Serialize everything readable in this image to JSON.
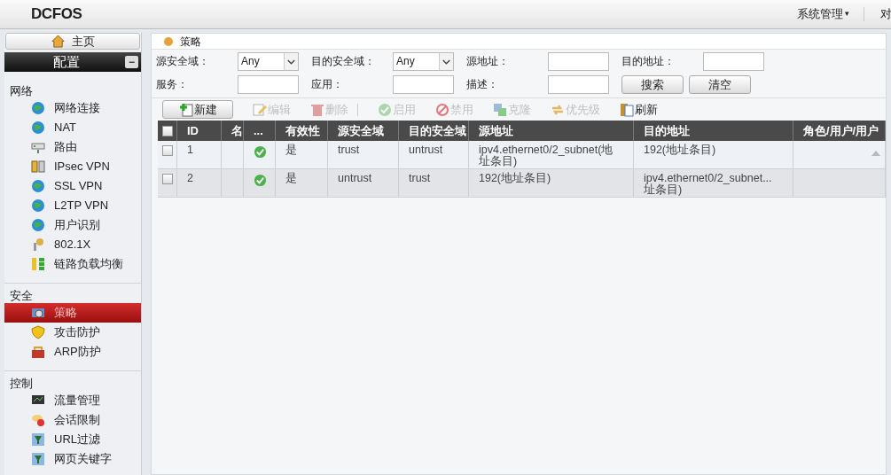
{
  "header": {
    "logo": "DCFOS",
    "menu": "系统管理",
    "menu_caret": "▾",
    "cut_item": "对"
  },
  "sidebar": {
    "home": "主页",
    "section": "配置",
    "collapse": "−",
    "groups": [
      {
        "title": "网络",
        "items": [
          {
            "label": "网络连接",
            "selected": false
          },
          {
            "label": "NAT",
            "selected": false
          },
          {
            "label": "路由",
            "selected": false
          },
          {
            "label": "IPsec VPN",
            "selected": false
          },
          {
            "label": "SSL VPN",
            "selected": false
          },
          {
            "label": "L2TP VPN",
            "selected": false
          },
          {
            "label": "用户识别",
            "selected": false
          },
          {
            "label": "802.1X",
            "selected": false
          },
          {
            "label": "链路负载均衡",
            "selected": false
          }
        ]
      },
      {
        "title": "安全",
        "items": [
          {
            "label": "策略",
            "selected": true
          },
          {
            "label": "攻击防护",
            "selected": false
          },
          {
            "label": "ARP防护",
            "selected": false
          }
        ]
      },
      {
        "title": "控制",
        "items": [
          {
            "label": "流量管理",
            "selected": false
          },
          {
            "label": "会话限制",
            "selected": false
          },
          {
            "label": "URL过滤",
            "selected": false
          },
          {
            "label": "网页关键字",
            "selected": false
          }
        ]
      }
    ]
  },
  "panel": {
    "title": "策略",
    "filters": [
      [
        {
          "label": "源安全域：",
          "kind": "select",
          "value": "Any"
        },
        {
          "label": "目的安全域：",
          "kind": "select",
          "value": "Any"
        },
        {
          "label": "源地址：",
          "kind": "input"
        },
        {
          "label": "目的地址：",
          "kind": "input"
        }
      ],
      [
        {
          "label": "服务：",
          "kind": "input"
        },
        {
          "label": "应用：",
          "kind": "input"
        },
        {
          "label": "描述：",
          "kind": "input"
        }
      ]
    ],
    "buttons": [
      "搜索",
      "清空"
    ],
    "toolbar": [
      {
        "label": "新建",
        "disabled": false
      },
      {
        "label": "编辑",
        "disabled": true
      },
      {
        "label": "删除",
        "disabled": true
      },
      {
        "label": "启用",
        "disabled": true
      },
      {
        "label": "禁用",
        "disabled": true
      },
      {
        "label": "克隆",
        "disabled": true
      },
      {
        "label": "优先级",
        "disabled": true
      },
      {
        "label": "刷新",
        "disabled": false
      }
    ],
    "table": {
      "select_all_checked": false,
      "columns": [
        "ID",
        "名",
        "...",
        "有效性",
        "源安全域",
        "目的安全域",
        "源地址",
        "目的地址",
        "角色/用户/用户"
      ],
      "rows": [
        {
          "checked": false,
          "enabled": true,
          "cells": [
            "1",
            "",
            "",
            "是",
            "trust",
            "untrust",
            "ipv4.ethernet0/2_subnet(地址条目)",
            "192(地址条目)",
            ""
          ]
        },
        {
          "checked": false,
          "enabled": true,
          "cells": [
            "2",
            "",
            "",
            "是",
            "untrust",
            "trust",
            "192(地址条目)",
            "ipv4.ethernet0/2_subnet...址条目)",
            ""
          ]
        }
      ]
    }
  }
}
